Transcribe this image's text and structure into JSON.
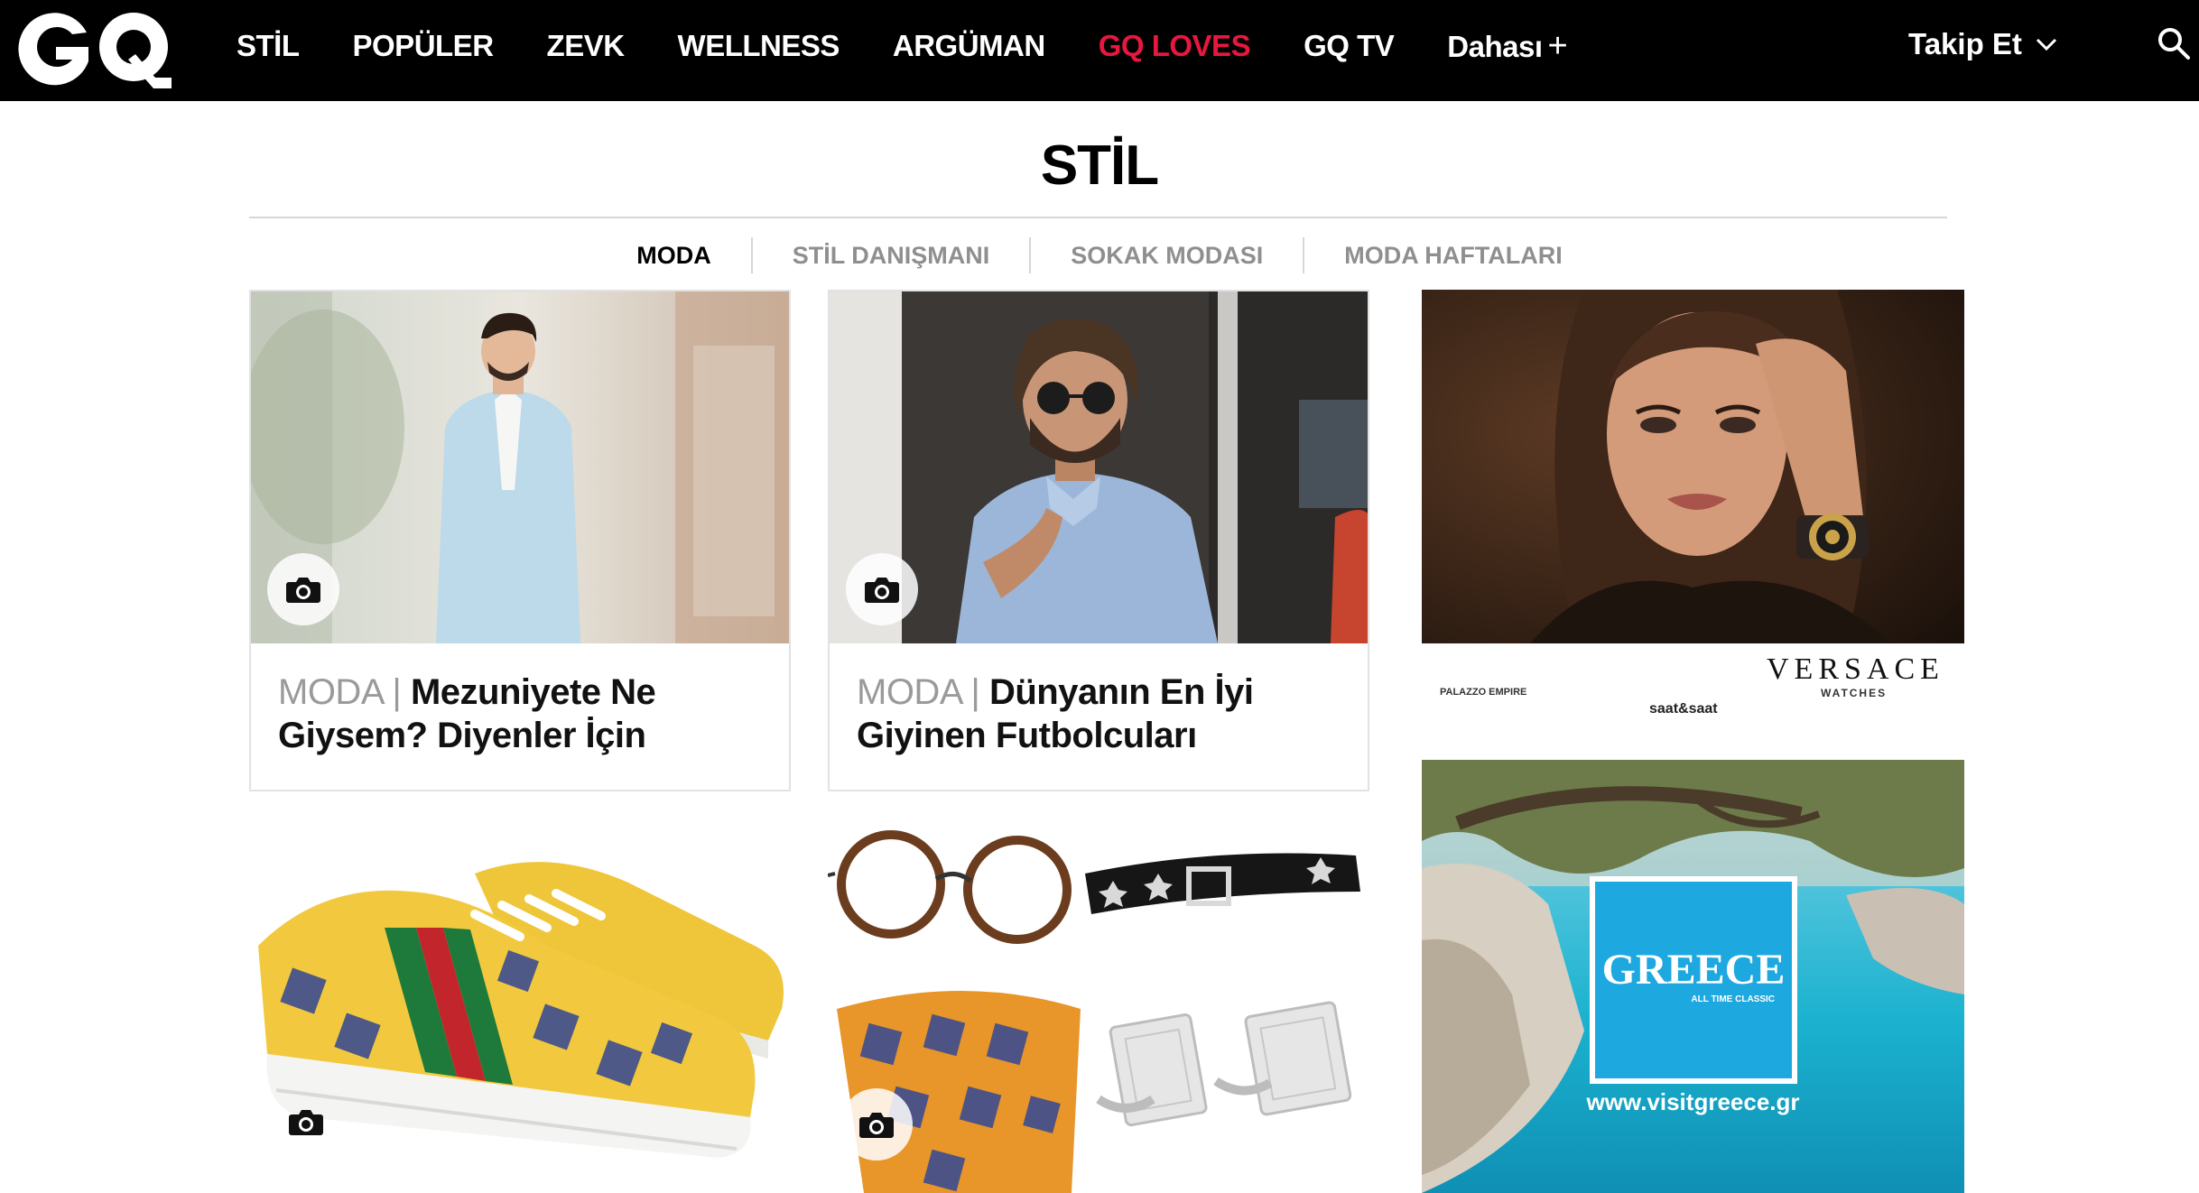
{
  "nav": {
    "logo": "GQ",
    "links": [
      "STİL",
      "POPÜLER",
      "ZEVK",
      "WELLNESS",
      "ARGÜMAN",
      "GQ LOVES",
      "GQ TV"
    ],
    "more_label": "Dahası",
    "more_symbol": "+",
    "follow_label": "Takip Et",
    "accent_color": "#e8173f"
  },
  "section": {
    "title": "STİL",
    "tabs": [
      "MODA",
      "STİL DANIŞMANI",
      "SOKAK MODASI",
      "MODA HAFTALARI"
    ],
    "active_tab": "MODA"
  },
  "articles": [
    {
      "category": "MODA",
      "separator": "|",
      "title": "Mezuniyete Ne Giysem? Diyenler İçin",
      "has_gallery": true
    },
    {
      "category": "MODA",
      "separator": "|",
      "title": "Dünyanın En İyi Giyinen Futbolcuları",
      "has_gallery": true
    },
    {
      "category": "",
      "title": "",
      "has_gallery": true
    },
    {
      "category": "",
      "title": "",
      "has_gallery": true
    }
  ],
  "ads": {
    "versace": {
      "brand": "VERSACE",
      "sub": "WATCHES",
      "retailer": "PALAZZO EMPIRE",
      "partner": "saat&saat"
    },
    "greece": {
      "title": "GREECE",
      "tagline": "ALL TIME CLASSIC",
      "url": "www.visitgreece.gr"
    }
  },
  "icons": [
    "gq-logo",
    "chevron-down-icon",
    "search-icon",
    "camera-icon"
  ]
}
